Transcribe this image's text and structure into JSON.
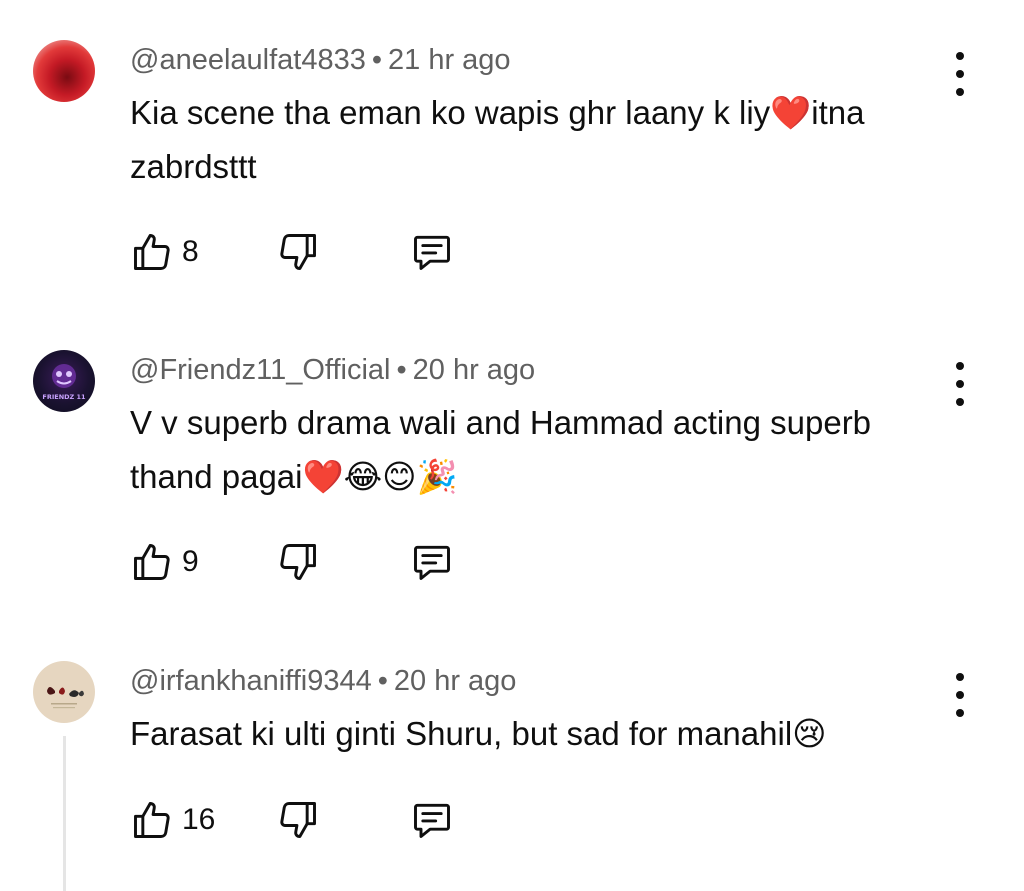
{
  "comments": [
    {
      "author": "@aneelaulfat4833",
      "time": "21 hr ago",
      "text": "Kia scene tha eman ko wapis ghr laany k liy❤️itna zabrdsttt",
      "likes": "8"
    },
    {
      "author": "@Friendz11_Official",
      "time": "20 hr ago",
      "text": "V v superb drama wali and Hammad acting superb thand pagai❤️😂😊🎉",
      "likes": "9",
      "avatar_text": "FRIENDZ 11"
    },
    {
      "author": "@irfankhaniffi9344",
      "time": "20 hr ago",
      "text": "Farasat ki ulti ginti Shuru, but sad for manahil😢",
      "likes": "16"
    }
  ],
  "meta_separator": "•",
  "icons": {
    "like": "thumbs-up-icon",
    "dislike": "thumbs-down-icon",
    "reply": "comment-reply-icon",
    "menu": "more-vertical-icon"
  },
  "colors": {
    "text": "#0f0f0f",
    "meta": "#606060",
    "thread_line": "#e5e5e5"
  }
}
